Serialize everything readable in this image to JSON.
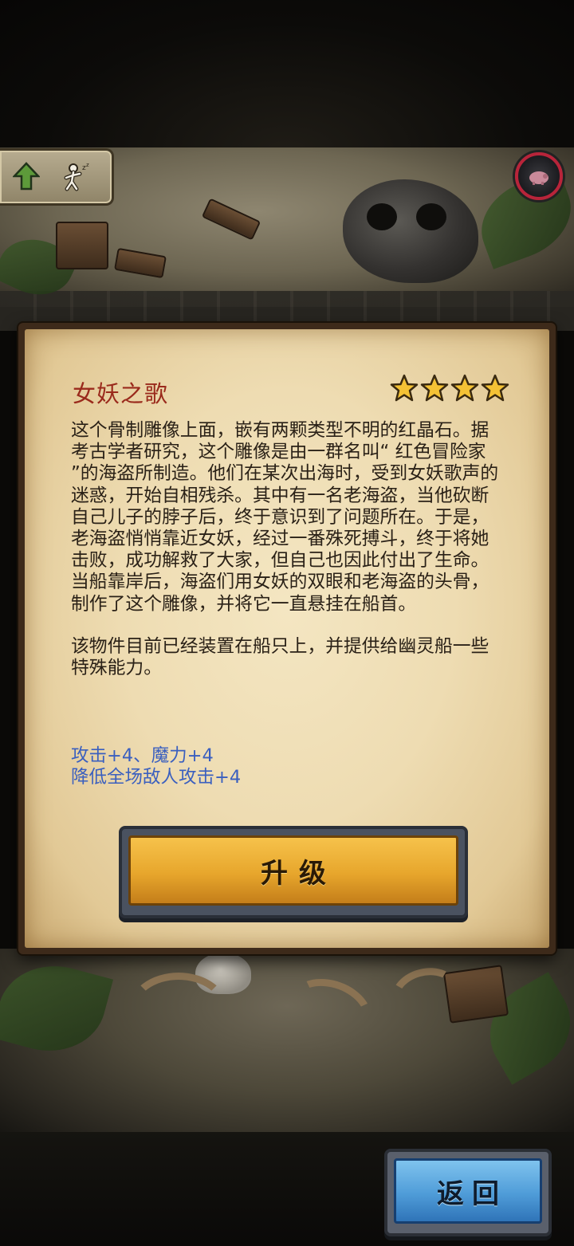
{
  "item": {
    "title": "女妖之歌",
    "stars": 4,
    "description": [
      "这个骨制雕像上面，嵌有两颗类型不明的红晶石。据考古学者研究，这个雕像是由一群名叫“ 红色冒险家 ”的海盗所制造。他们在某次出海时，受到女妖歌声的迷惑，开始自相残杀。其中有一名老海盗，当他砍断自己儿子的脖子后，终于意识到了问题所在。于是，老海盗悄悄靠近女妖，经过一番殊死搏斗，终于将她击败，成功解救了大家，但自己也因此付出了生命。当船靠岸后，海盗们用女妖的双眼和老海盗的头骨，制作了这个雕像，并将它一直悬挂在船首。",
      "该物件目前已经装置在船只上，并提供给幽灵船一些特殊能力。"
    ],
    "stats": [
      "攻击+4、魔力+4",
      "降低全场敌人攻击+4"
    ]
  },
  "buttons": {
    "upgrade_label": "升级",
    "back_label": "返回"
  },
  "icons": {
    "up": "up-arrow-icon",
    "runner": "runner-icon",
    "badge": "pig-badge-icon",
    "star": "star-icon"
  },
  "colors": {
    "title": "#9a2a1c",
    "stats": "#3a5fbf",
    "upgrade": "#e7a62c",
    "back": "#4f9cd8",
    "badge_ring": "#b8243a"
  }
}
